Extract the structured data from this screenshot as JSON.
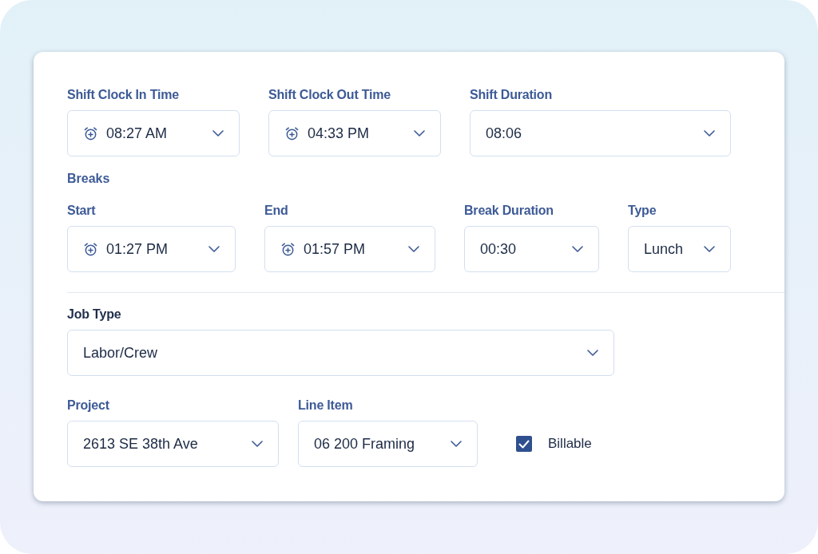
{
  "shift": {
    "fields": [
      {
        "kind": "time",
        "label": "Shift Clock In Time",
        "value": "08:27 AM"
      },
      {
        "kind": "time",
        "label": "Shift Clock Out Time",
        "value": "04:33 PM"
      },
      {
        "kind": "plain",
        "label": "Shift Duration",
        "value": "08:06"
      }
    ]
  },
  "breaks": {
    "title": "Breaks",
    "fields": [
      {
        "kind": "time",
        "label": "Start",
        "value": "01:27 PM"
      },
      {
        "kind": "time",
        "label": "End",
        "value": "01:57 PM"
      },
      {
        "kind": "plain",
        "label": "Break Duration",
        "value": "00:30"
      },
      {
        "kind": "plain",
        "label": "Type",
        "value": "Lunch"
      }
    ]
  },
  "job_type": {
    "label": "Job Type",
    "value": "Labor/Crew"
  },
  "assignment": {
    "fields": [
      {
        "kind": "plain",
        "label": "Project",
        "value": "2613 SE 38th Ave"
      },
      {
        "kind": "plain",
        "label": "Line Item",
        "value": "06 200 Framing"
      }
    ],
    "billable": {
      "label": "Billable",
      "checked": true
    }
  }
}
